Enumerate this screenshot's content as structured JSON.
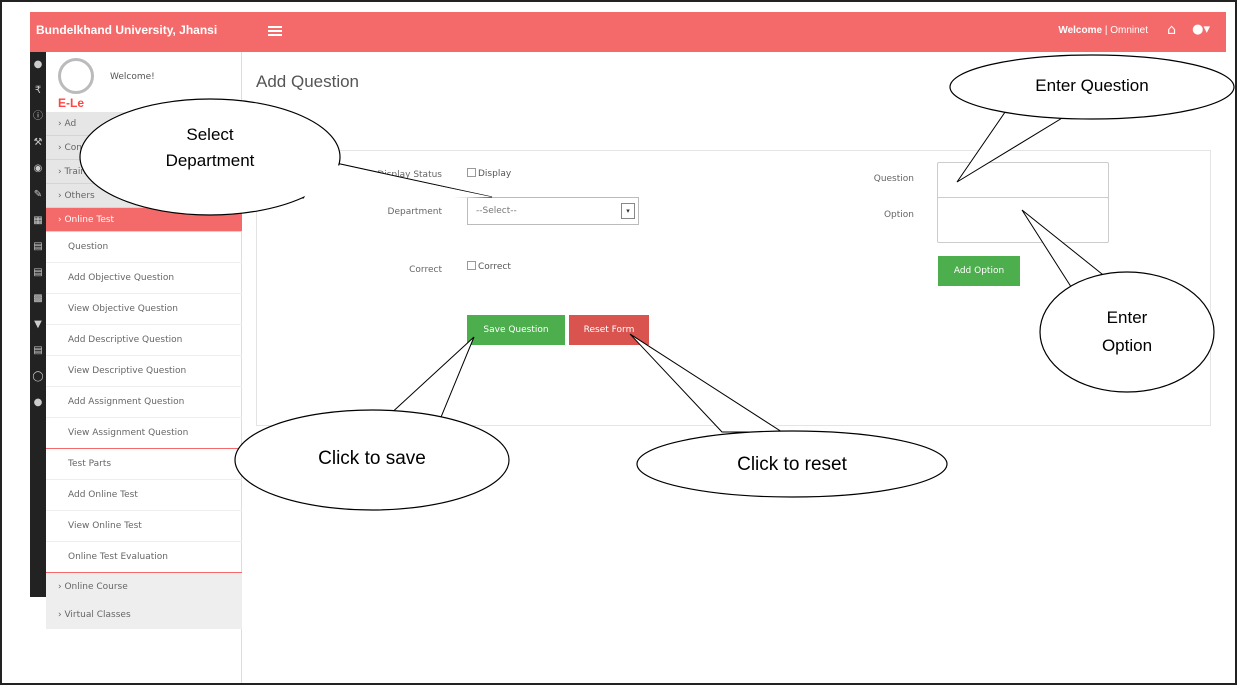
{
  "header": {
    "brand": "Bundelkhand University, Jhansi",
    "welcome_prefix": "Welcome",
    "welcome_user": "| Omninet"
  },
  "profile": {
    "welcome": "Welcome!",
    "section_title": "E-Le"
  },
  "sidebar": {
    "groups_top": [
      "Ad",
      "Conte",
      "Training",
      "Others"
    ],
    "active_group": "Online Test",
    "items": [
      "Question",
      "Add Objective Question",
      "View Objective Question",
      "Add Descriptive Question",
      "View Descriptive Question",
      "Add Assignment Question",
      "View Assignment Question",
      "Test Parts",
      "Add Online Test",
      "View Online Test",
      "Online Test Evaluation"
    ],
    "groups_bottom": [
      "Online Course",
      "Virtual Classes"
    ]
  },
  "page": {
    "title": "Add Question"
  },
  "form": {
    "display_status_label": "Display Status",
    "display_checkbox": "Display",
    "department_label": "Department",
    "department_value": "--Select--",
    "correct_label": "Correct",
    "correct_checkbox": "Correct",
    "question_label": "Question",
    "option_label": "Option",
    "add_option_label": "Add Option",
    "save_label": "Save Question",
    "reset_label": "Reset Form"
  },
  "callouts": {
    "select_department": "Select\nDepartment",
    "enter_question": "Enter Question",
    "enter_option": "Enter\nOption",
    "click_to_save": "Click to save",
    "click_to_reset": "Click to reset"
  },
  "colors": {
    "accent": "#f46a6a",
    "green": "#4cae4c",
    "red": "#d9534f"
  }
}
